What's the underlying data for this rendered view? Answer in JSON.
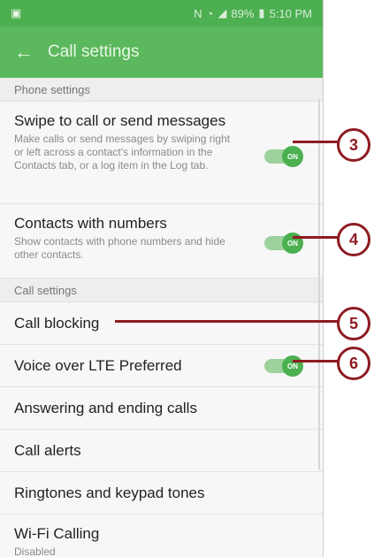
{
  "status_bar": {
    "left_icon": "image-icon",
    "battery": "89%",
    "time": "5:10 PM"
  },
  "app_bar": {
    "title": "Call settings"
  },
  "sections": {
    "phone": {
      "header": "Phone settings",
      "swipe": {
        "title": "Swipe to call or send messages",
        "desc": "Make calls or send messages by swiping right or left across a contact's information in the Contacts tab, or a log item in the Log tab.",
        "toggle": "ON"
      },
      "contacts": {
        "title": "Contacts with numbers",
        "desc": "Show contacts with phone numbers and hide other contacts.",
        "toggle": "ON"
      }
    },
    "call": {
      "header": "Call settings",
      "blocking": "Call blocking",
      "volte": {
        "title": "Voice over LTE Preferred",
        "toggle": "ON"
      },
      "answering": "Answering and ending calls",
      "alerts": "Call alerts",
      "ringtones": "Ringtones and keypad tones",
      "wifi": {
        "title": "Wi-Fi Calling",
        "sub": "Disabled"
      }
    }
  },
  "callouts": [
    "3",
    "4",
    "5",
    "6"
  ]
}
